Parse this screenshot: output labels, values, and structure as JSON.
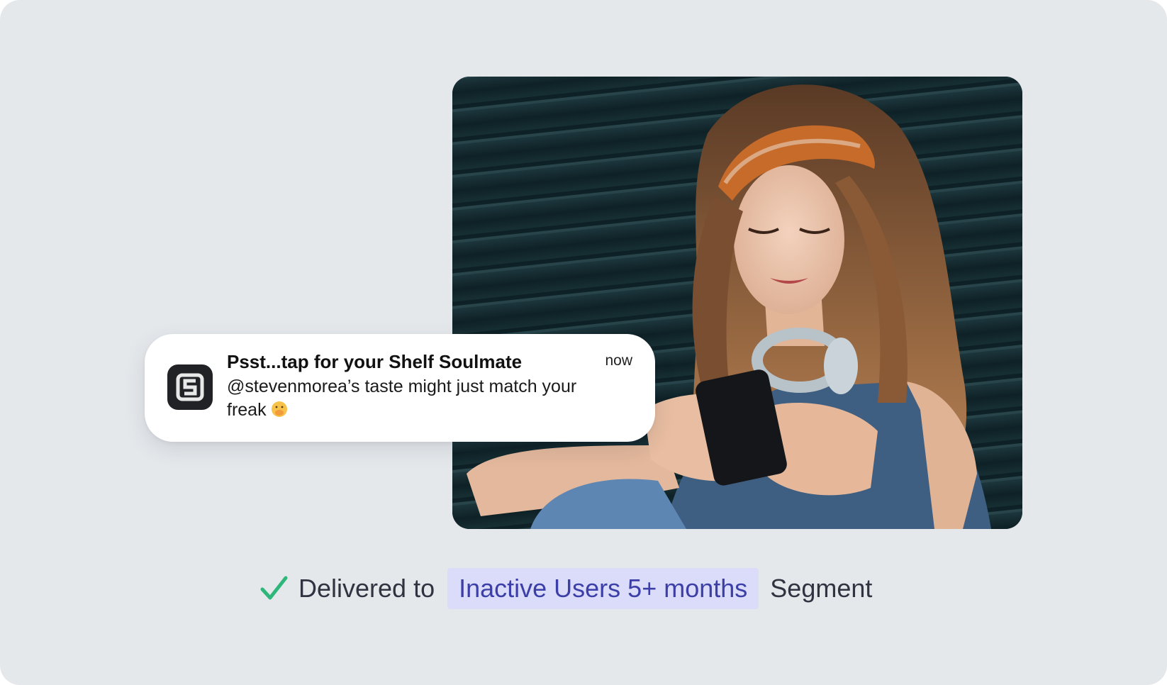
{
  "notification": {
    "app_icon": "shelf-soulmate-logo-icon",
    "title": "Psst...tap for your Shelf Soulmate",
    "time": "now",
    "body": "@stevenmorea’s taste might just match your freak",
    "emoji": "face-with-hand-over-mouth"
  },
  "delivery": {
    "check_icon": "check-icon",
    "prefix": "Delivered to",
    "segment": "Inactive Users 5+ months",
    "suffix": "Segment"
  },
  "colors": {
    "background": "#e5e8eb",
    "check": "#2fb67a",
    "segment_pill_bg": "#dadcf9",
    "segment_pill_text": "#3c3fa8"
  }
}
